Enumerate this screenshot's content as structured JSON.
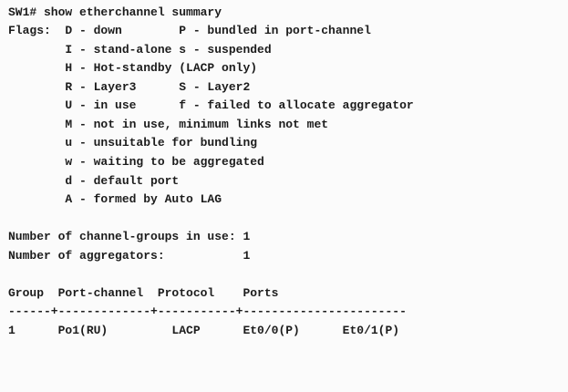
{
  "terminal": {
    "lines": [
      "SW1# show etherchannel summary",
      "Flags:  D - down        P - bundled in port-channel",
      "        I - stand-alone s - suspended",
      "        H - Hot-standby (LACP only)",
      "        R - Layer3      S - Layer2",
      "        U - in use      f - failed to allocate aggregator",
      "        M - not in use, minimum links not met",
      "        u - unsuitable for bundling",
      "        w - waiting to be aggregated",
      "        d - default port",
      "        A - formed by Auto LAG",
      "",
      "Number of channel-groups in use: 1",
      "Number of aggregators:           1",
      "",
      "Group  Port-channel  Protocol    Ports",
      "------+-------------+-----------+-----------------------",
      "1      Po1(RU)         LACP      Et0/0(P)      Et0/1(P)"
    ]
  }
}
